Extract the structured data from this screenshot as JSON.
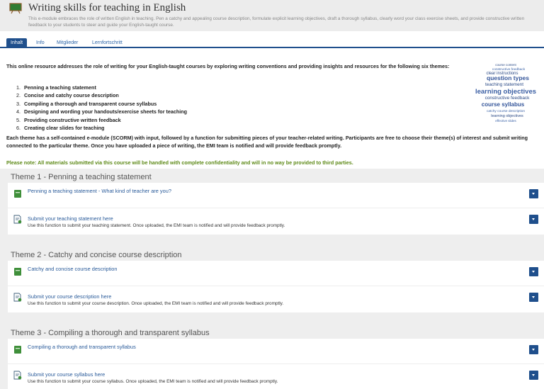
{
  "course": {
    "title": "Writing skills for teaching in English",
    "description": "This e-module embraces the role of written English in teaching. Pen a catchy and appealing course description, formulate explicit learning objectives, draft a thorough syllabus, clearly word your class exercise sheets, and provide constructive written feedback to your students to steer and guide your English-taught course."
  },
  "tabs": [
    "Inhalt",
    "Info",
    "Mitglieder",
    "Lernfortschritt"
  ],
  "intro": {
    "lead": "This online resource addresses the role of writing for your English-taught courses by exploring writing conventions and providing insights and resources for the following six themes:",
    "themes": [
      "Penning a teaching statement",
      "Concise and catchy course description",
      "Compiling a thorough and transparent course syllabus",
      "Designing and wording your handouts/exercise sheets for teaching",
      "Providing constructive written feedback",
      "Creating clear slides for teaching"
    ],
    "body": "Each theme has a self-contained e-module (SCORM) with input, followed by a function for submitting pieces of your teacher-related writing. Participants are free to choose their theme(s) of interest and submit writing connected to the particular theme. Once you have uploaded a piece of writing, the EMI team is notified and will provide feedback promptly.",
    "note": "Please note: All materials submitted via this course will be handled with complete confidentiality and will in no way be provided to third parties."
  },
  "wordcloud": [
    "course content",
    "constructive feedback",
    "clear instructions",
    "question types",
    "teaching statement",
    "learning objectives",
    "constructive feedback",
    "course syllabus",
    "catchy course description",
    "learning objectives",
    "effective slides"
  ],
  "sections": [
    {
      "title": "Theme 1 - Penning a teaching statement",
      "module": "Penning a teaching statement - What kind of teacher are you?",
      "submit_title": "Submit your teaching statement here",
      "submit_desc": "Use this function to submit your teaching statement. Once uploaded, the EMI team is notified and will provide feedback promptly."
    },
    {
      "title": "Theme 2 - Catchy and concise course description",
      "module": "Catchy and concise course description",
      "submit_title": "Submit your course description here",
      "submit_desc": "Use this function to submit your course description. Once uploaded, the EMI team is notified and will provide feedback promptly."
    },
    {
      "title": "Theme 3 - Compiling a thorough and transparent syllabus",
      "module": "Compiling a thorough and transparent syllabus",
      "submit_title": "Submit your course syllabus here",
      "submit_desc": "Use this function to submit your course syllabus. Once uploaded, the EMI team is notified and will provide feedback promptly."
    }
  ],
  "colors": {
    "accent": "#1f4f8c",
    "link": "#2a5b9a",
    "note": "#5e8a18",
    "module_icon": "#3f8f3a"
  },
  "icons": {
    "course": "chalkboard-icon",
    "module": "scorm-module-icon",
    "submit": "submit-document-icon",
    "action": "chevron-down-icon"
  }
}
